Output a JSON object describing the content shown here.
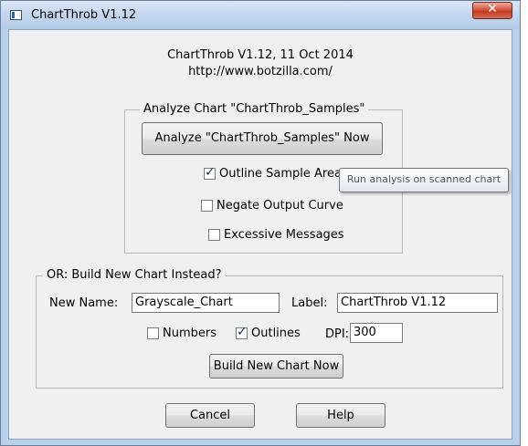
{
  "window": {
    "title": "ChartThrob V1.12",
    "close_glyph": "✕"
  },
  "header": {
    "line1": "ChartThrob V1.12, 11 Oct 2014",
    "line2": "http://www.botzilla.com/"
  },
  "analyze_group": {
    "title": "Analyze Chart \"ChartThrob_Samples\"",
    "analyze_button": "Analyze \"ChartThrob_Samples\" Now",
    "outline_sample_areas": {
      "label": "Outline Sample Areas",
      "checked": true
    },
    "negate_output_curve": {
      "label": "Negate Output Curve",
      "checked": false
    },
    "excessive_messages": {
      "label": "Excessive Messages",
      "checked": false
    }
  },
  "tooltip": "Run analysis on scanned chart",
  "build_group": {
    "title": "OR: Build New Chart Instead?",
    "new_name_label": "New Name:",
    "new_name_value": "Grayscale_Chart",
    "label_label": "Label:",
    "label_value": "ChartThrob V1.12",
    "numbers": {
      "label": "Numbers",
      "checked": false
    },
    "outlines": {
      "label": "Outlines",
      "checked": true
    },
    "dpi_label": "DPI:",
    "dpi_value": "300",
    "build_button": "Build New Chart Now"
  },
  "footer": {
    "cancel_button": "Cancel",
    "help_button": "Help"
  },
  "check_glyph": "✓",
  "colors": {
    "window_frame": "#b9d1ea",
    "dialog_bg": "#f0f0f0",
    "close_button": "#c9452c"
  }
}
